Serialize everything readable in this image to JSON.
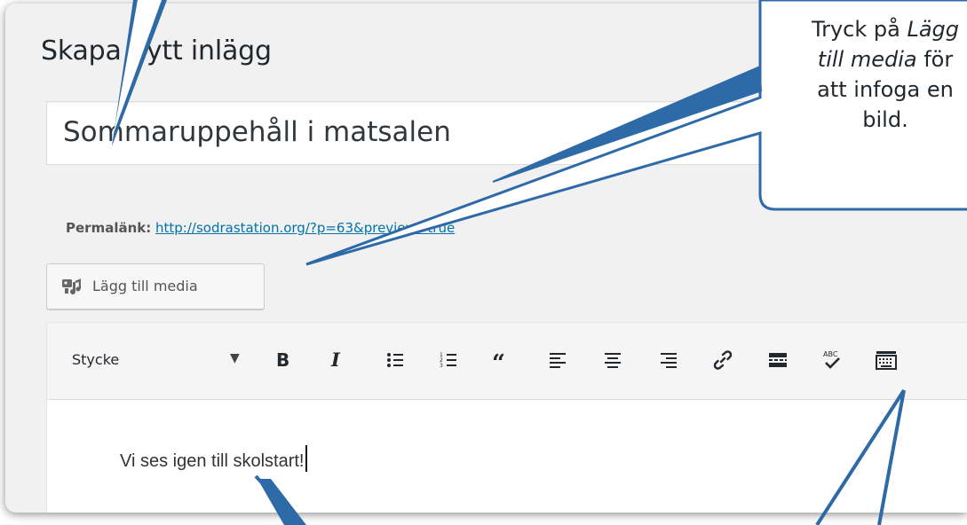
{
  "page": {
    "title": "Skapa nytt inlägg"
  },
  "post": {
    "title_value": "Sommaruppehåll i matsalen",
    "permalink_label": "Permalänk:",
    "permalink_url": "http://sodrastation.org/?p=63&preview=true"
  },
  "media": {
    "button_label": "Lägg till media",
    "icon": "add-media-icon"
  },
  "toolbar": {
    "format_select": "Stycke",
    "buttons": [
      "bold",
      "italic",
      "bulleted-list",
      "numbered-list",
      "blockquote",
      "align-left",
      "align-center",
      "align-right",
      "insert-link",
      "read-more",
      "spellcheck",
      "toolbar-toggle"
    ]
  },
  "editor": {
    "content": "Vi ses igen till skolstart!"
  },
  "callout": {
    "line1": "Tryck på ",
    "line1_em": "Lägg",
    "line2_em": "till media",
    "line2": " för",
    "line3": "att infoga en",
    "line4": "bild."
  },
  "colors": {
    "arrow": "#2e6aa8",
    "link": "#0073aa",
    "callout_border": "#2e6aa8"
  }
}
